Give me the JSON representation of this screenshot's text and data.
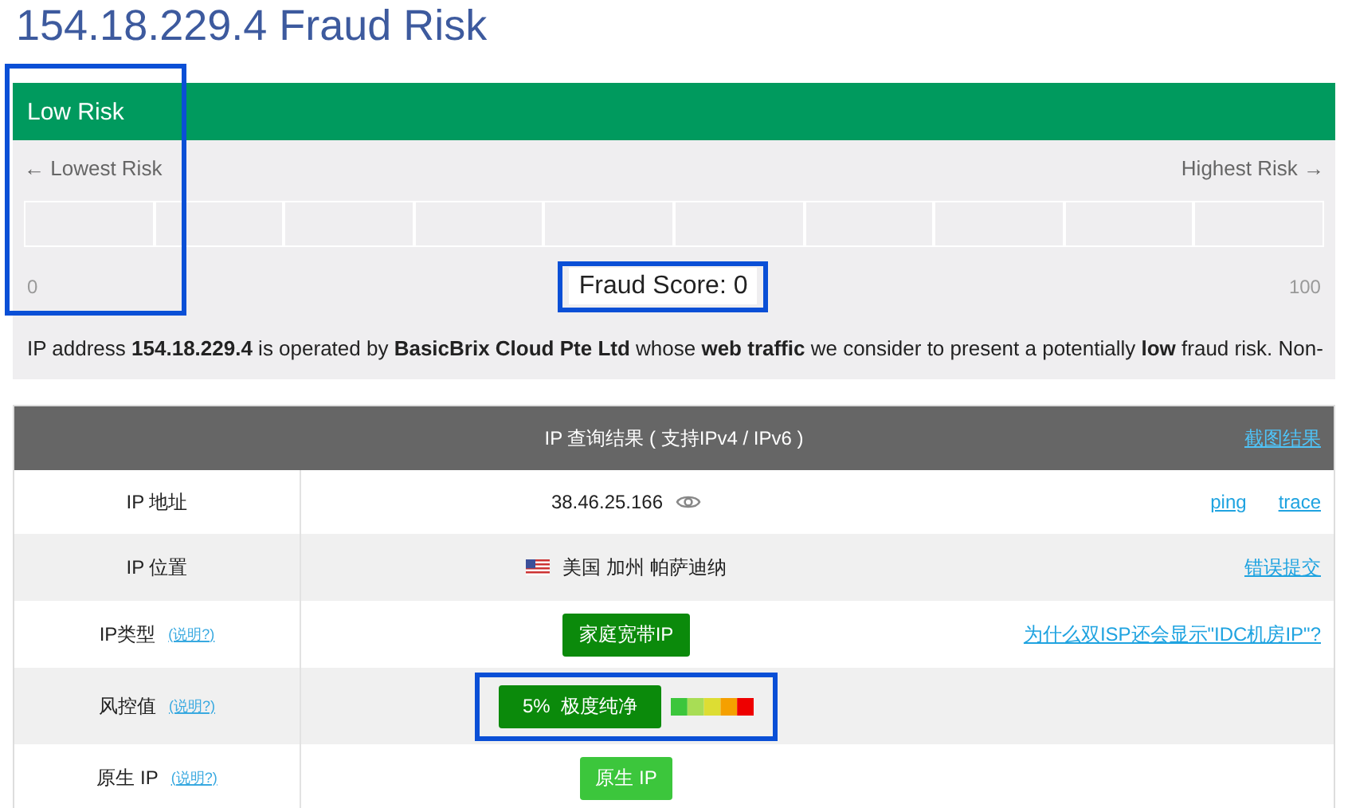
{
  "title": "154.18.229.4 Fraud Risk",
  "risk_panel": {
    "header": "Low Risk",
    "left_label": "← Lowest Risk",
    "right_label": "Highest Risk →",
    "min": "0",
    "max": "100",
    "score": "Fraud Score: 0",
    "start_highlighted": true,
    "score_highlighted": true,
    "description": "IP address **154.18.229.4** is operated by **BasicBrix Cloud Pte Ltd** whose **web traffic** we consider to present a potentially **low** fraud risk. Non-"
  },
  "result_table": {
    "title": "IP 查询结果 ( 支持IPv4 / IPv6 )",
    "header_link": "截图结果",
    "rows": [
      {
        "label": "IP 地址",
        "kind": "address",
        "value": "38.46.25.166",
        "links": [
          "ping",
          "trace"
        ]
      },
      {
        "label": "IP 位置",
        "kind": "location",
        "value": "美国 加州 帕萨迪纳",
        "links": [
          "错误提交"
        ]
      },
      {
        "label": "IP类型",
        "hint": "(说明?)",
        "kind": "tag",
        "value": "家庭宽带IP",
        "color": "#0b8a0b",
        "links": [
          "为什么双ISP还会显示\"IDC机房IP\"?"
        ]
      },
      {
        "label": "风控值",
        "hint": "(说明?)",
        "kind": "risk",
        "value": "5%  极度纯净",
        "color": "#0b8a0b",
        "highlighted": true
      },
      {
        "label": "原生 IP",
        "hint": "(说明?)",
        "kind": "tag",
        "value": "原生 IP",
        "color": "#3cc63c"
      }
    ]
  }
}
